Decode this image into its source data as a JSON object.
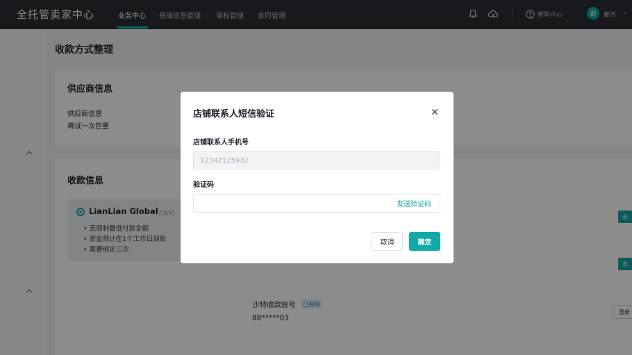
{
  "header": {
    "logo": "全托管卖家中心",
    "nav": [
      "业务中心",
      "基础信息管理",
      "商标管理",
      "合同管理"
    ],
    "active_nav": "业务中心",
    "help_label": "帮助中心",
    "user_avatar": "都",
    "user_name": "都市",
    "icons": [
      "bell-icon",
      "cloud-icon",
      "help-circle-icon",
      "chevron-down-icon"
    ]
  },
  "page": {
    "title": "收款方式整理",
    "supplier_section": {
      "title": "供应商信息",
      "label": "供应商信息",
      "value": "再试一次巨量"
    },
    "payment_section": {
      "title": "收款信息",
      "method_name": "LianLian Global",
      "currency": "（CNY）",
      "bullets": [
        "无限制最低付款金额",
        "资金预计在1个工作日到账",
        "需要绑定三次"
      ]
    },
    "right_buttons": [
      "去",
      "去"
    ],
    "account_label": "沙特收款账号",
    "account_badge": "已授权",
    "account_number": "88*****03",
    "rebind_label": "重新"
  },
  "dialog": {
    "title": "店铺联系人短信验证",
    "phone_label": "店铺联系人手机号",
    "phone_value": "12342125932",
    "code_label": "验证码",
    "code_value": "",
    "send_code": "发送验证码",
    "cancel": "取消",
    "confirm": "确定"
  },
  "colors": {
    "accent": "#13a8a8",
    "topbar": "#2b2e33"
  }
}
